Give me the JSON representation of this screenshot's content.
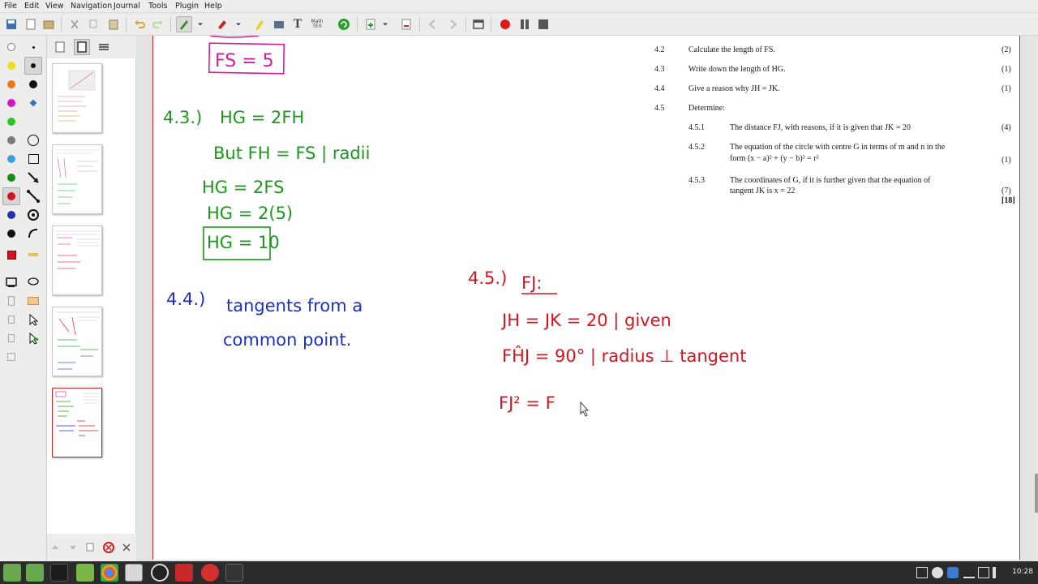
{
  "menu": [
    "File",
    "Edit",
    "View",
    "Navigation",
    "Journal",
    "Tools",
    "Plugin",
    "Help"
  ],
  "question": {
    "items": [
      {
        "num": "4.2",
        "text": "Calculate the length of  FS.",
        "marks": "(2)"
      },
      {
        "num": "4.3",
        "text": "Write down the length of  HG.",
        "marks": "(1)"
      },
      {
        "num": "4.4",
        "text": "Give a reason why  JH = JK.",
        "marks": "(1)"
      },
      {
        "num": "4.5",
        "text": "Determine:",
        "marks": ""
      }
    ],
    "sub": [
      {
        "num": "4.5.1",
        "text": "The distance  FJ,  with reasons, if it is given that  JK = 20",
        "marks": "(4)"
      },
      {
        "num": "4.5.2",
        "line1": "The equation of the circle with centre   G  in terms of   m   and   n   in the",
        "line2": "form  (x − a)² + (y − b)² = r²",
        "marks": "(1)"
      },
      {
        "num": "4.5.3",
        "line1": "The coordinates of   G,   if it is further given that  the equation of",
        "line2": "tangent  JK  is  x = 22",
        "marks": "(7)"
      }
    ],
    "total": "[18]"
  },
  "handwriting": {
    "fs_box": "FS = 5",
    "h43": "4.3.)",
    "h43_l1": "HG = 2FH",
    "h43_l2": "But FH = FS | radii",
    "h43_l3": "HG = 2FS",
    "h43_l4": "HG = 2(5)",
    "h43_box": "HG = 10",
    "h44": "4.4.)",
    "h44_l1": "tangents from a",
    "h44_l2": "common point.",
    "h45": "4.5.)",
    "h45_title": "FJ:",
    "h45_l1": "JH = JK = 20 | given",
    "h45_l2": "FĤJ = 90° | radius ⊥ tangent",
    "h45_l3": "FJ² = F"
  },
  "colors": {
    "pink": "#d81b9a",
    "green": "#1a9a1a",
    "blue": "#1a2fc9",
    "red": "#d9131d",
    "pageborder": "#c62828"
  },
  "clock": "10:28"
}
